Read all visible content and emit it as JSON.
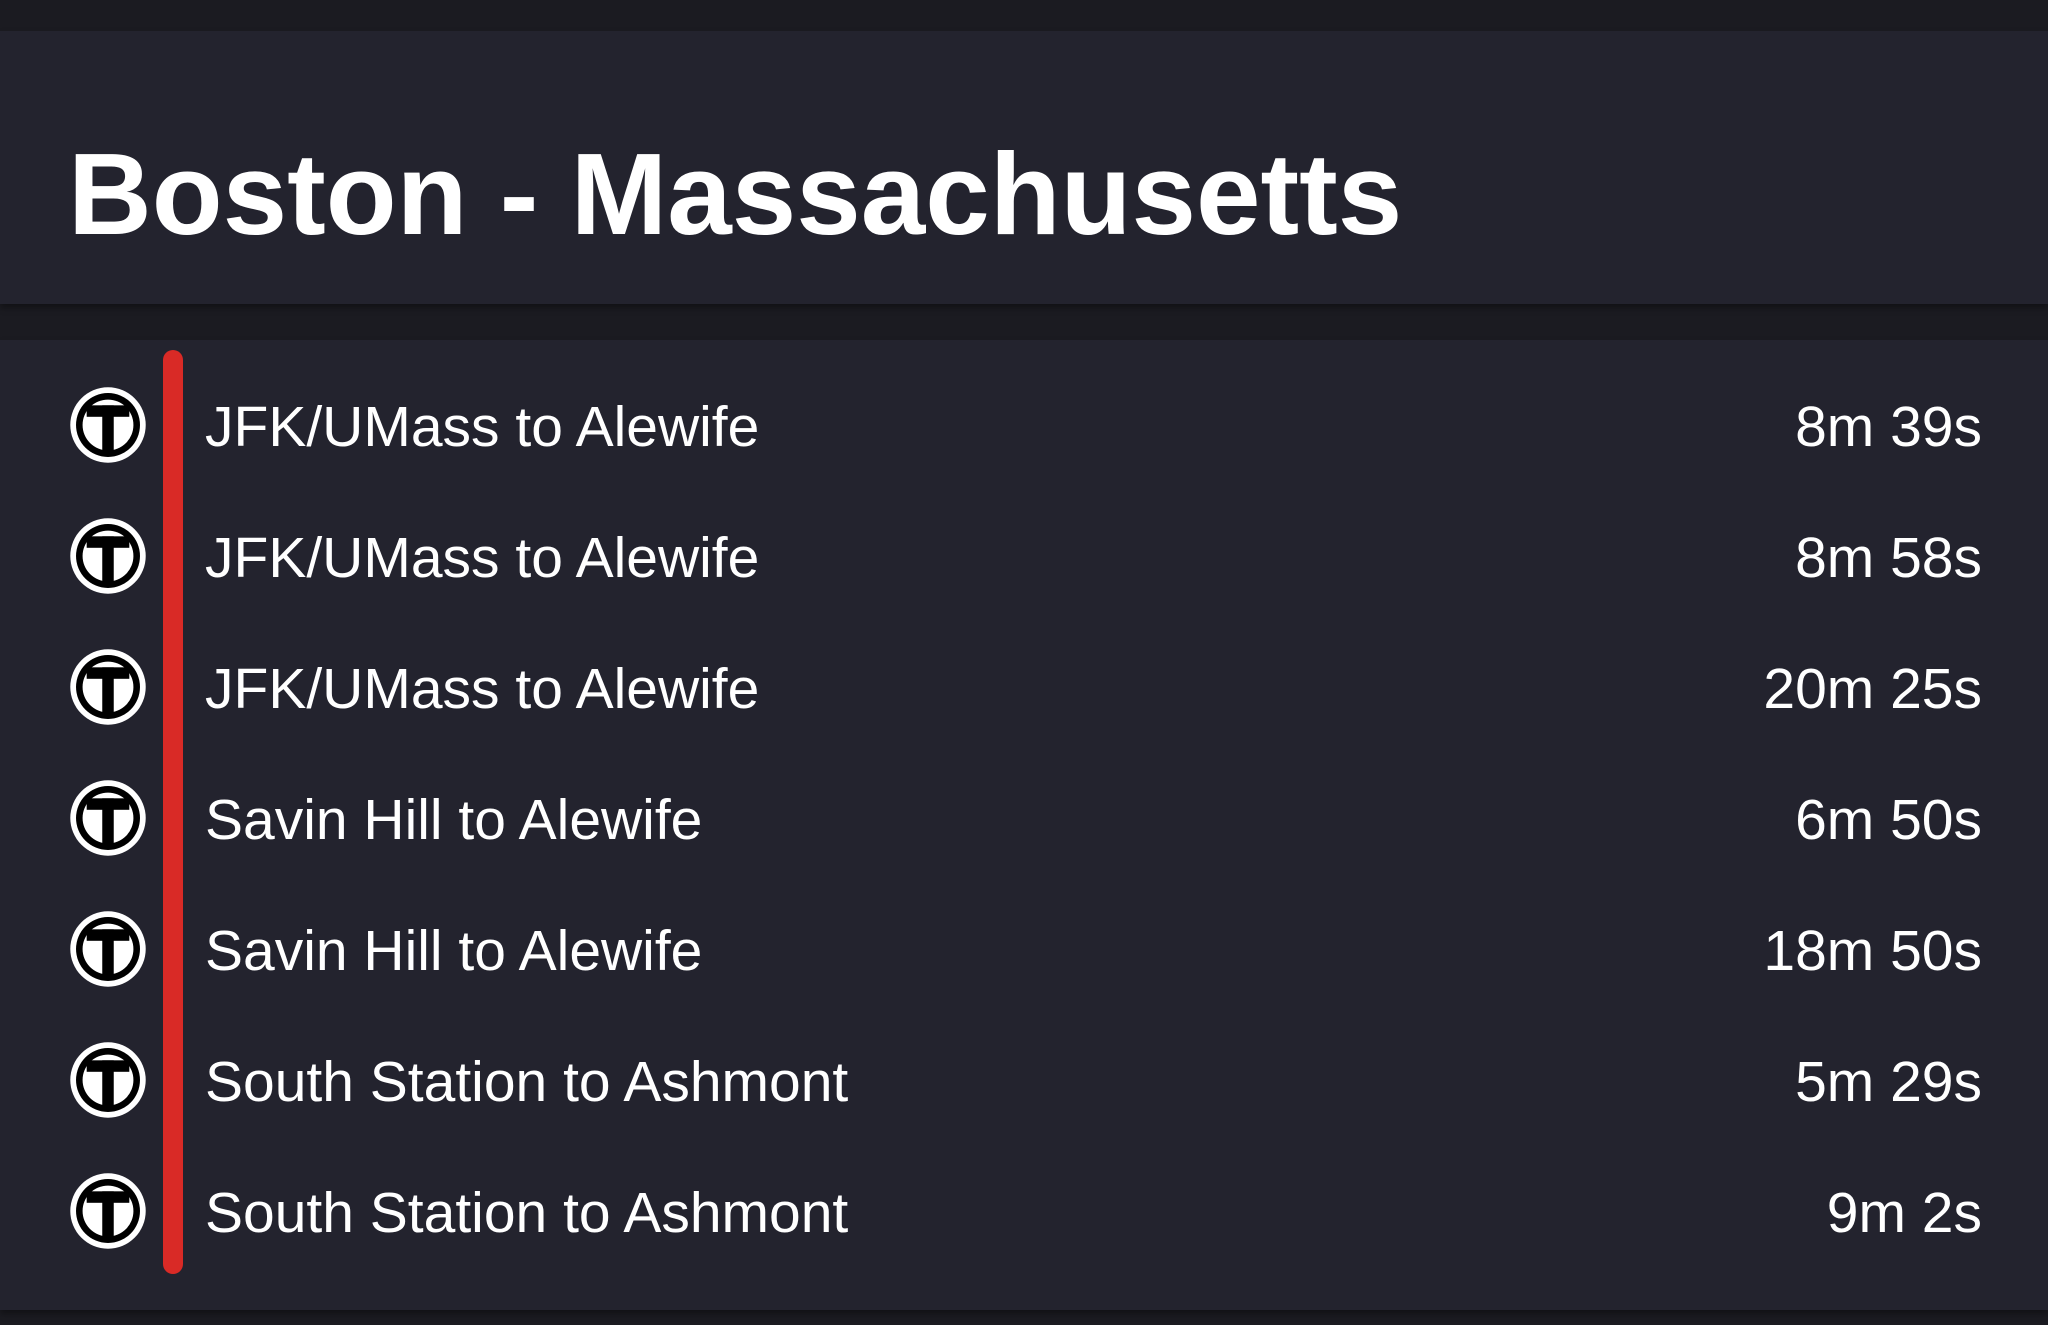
{
  "header": {
    "title": "Boston - Massachusetts"
  },
  "route": {
    "line_color": "#d92a26",
    "icon": "mbta-t-icon"
  },
  "trips": [
    {
      "name": "JFK/UMass to Alewife",
      "time": "8m 39s"
    },
    {
      "name": "JFK/UMass to Alewife",
      "time": "8m 58s"
    },
    {
      "name": "JFK/UMass to Alewife",
      "time": "20m 25s"
    },
    {
      "name": "Savin Hill to Alewife",
      "time": "6m 50s"
    },
    {
      "name": "Savin Hill to Alewife",
      "time": "18m 50s"
    },
    {
      "name": "South Station to Ashmont",
      "time": "5m 29s"
    },
    {
      "name": "South Station to Ashmont",
      "time": "9m 2s"
    }
  ]
}
